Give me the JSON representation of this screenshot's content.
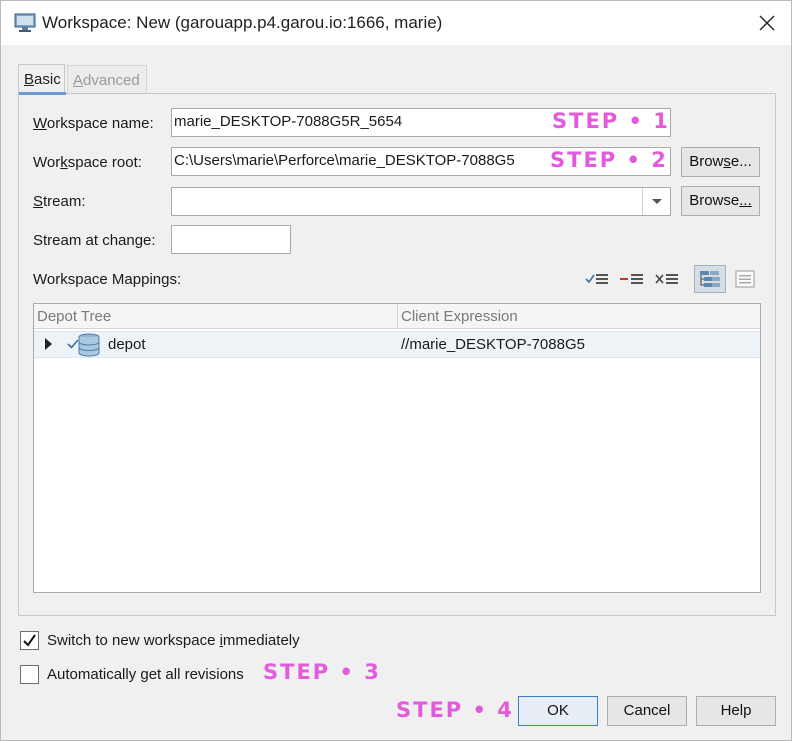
{
  "window": {
    "title": "Workspace: New (garouapp.p4.garou.io:1666,  marie)",
    "close_glyph": "✕"
  },
  "tabs": [
    {
      "label": "Basic",
      "active": true
    },
    {
      "label": "Advanced",
      "active": false
    }
  ],
  "form": {
    "workspace_name": {
      "label_underline": "W",
      "label_rest": "orkspace name:",
      "value": "marie_DESKTOP-7088G5R_5654"
    },
    "workspace_root": {
      "label_pre": "Wor",
      "label_underline": "k",
      "label_rest": "space root:",
      "value": "C:\\Users\\marie\\Perforce\\marie_DESKTOP-7088G5",
      "browse": {
        "pre": "Brow",
        "underline": "s",
        "rest": "e..."
      }
    },
    "stream": {
      "label_underline": "S",
      "label_rest": "tream:",
      "value": "",
      "browse": {
        "pre": "Browse",
        "underline": "",
        "rest": "",
        "underline_tail": "..."
      }
    },
    "stream_at_change": {
      "label": "Stream at change:",
      "value": ""
    }
  },
  "mappings": {
    "label": "Workspace Mappings:",
    "toolbar_icons": [
      "include-tree-icon",
      "exclude-tree-icon",
      "clear-tree-icon",
      "tree-view-icon",
      "text-view-icon"
    ],
    "columns": [
      "Depot Tree",
      "Client Expression"
    ],
    "rows": [
      {
        "name": "depot",
        "client_expression": "//marie_DESKTOP-7088G5"
      }
    ]
  },
  "options": {
    "switch_workspace": {
      "pre": "Switch to new workspace ",
      "underline": "i",
      "rest": "mmediately",
      "checked": true
    },
    "get_revisions": {
      "pre": "Automatically ",
      "underline": "g",
      "rest": "et all revisions",
      "checked": false
    }
  },
  "buttons": {
    "ok": "OK",
    "cancel": "Cancel",
    "help": "Help"
  },
  "steps": {
    "s1": "STEP • 1",
    "s2": "STEP • 2",
    "s3": "STEP • 3",
    "s4": "STEP • 4"
  },
  "colors": {
    "step_accent": "#e35bdc",
    "tab_accent": "#6b9bd1",
    "row_highlight": "#eef3f8"
  }
}
